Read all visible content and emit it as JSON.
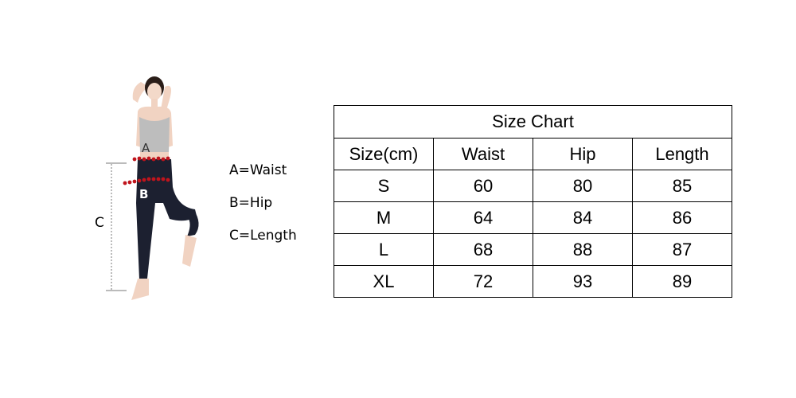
{
  "figure": {
    "marker_a": "A",
    "marker_b": "B",
    "marker_c": "C",
    "marker_color": "#c0141c"
  },
  "legend": {
    "a": "A=Waist",
    "b": "B=Hip",
    "c": "C=Length"
  },
  "size_chart": {
    "title": "Size Chart",
    "headers": [
      "Size(cm)",
      "Waist",
      "Hip",
      "Length"
    ],
    "rows": [
      [
        "S",
        "60",
        "80",
        "85"
      ],
      [
        "M",
        "64",
        "84",
        "86"
      ],
      [
        "L",
        "68",
        "88",
        "87"
      ],
      [
        "XL",
        "72",
        "93",
        "89"
      ]
    ]
  }
}
